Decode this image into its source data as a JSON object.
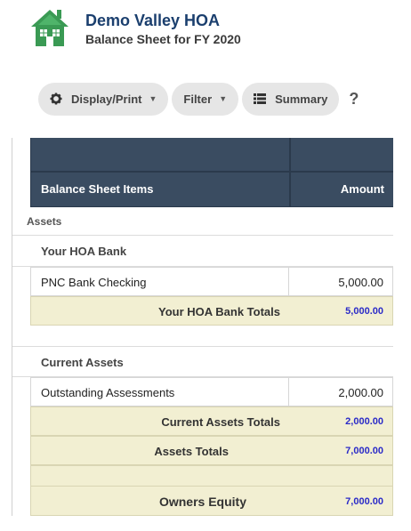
{
  "header": {
    "org_name": "Demo Valley HOA",
    "report_title": "Balance Sheet for FY 2020",
    "logo_icon": "house-icon",
    "logo_color": "#3a9a54"
  },
  "toolbar": {
    "display_print_label": "Display/Print",
    "filter_label": "Filter",
    "summary_label": "Summary",
    "help_label": "?"
  },
  "table": {
    "header_color": "#3a4c61",
    "columns": {
      "items": "Balance Sheet Items",
      "amount": "Amount"
    }
  },
  "assets": {
    "label": "Assets",
    "groups": [
      {
        "name": "Your HOA Bank",
        "items": [
          {
            "name": "PNC Bank Checking",
            "amount": "5,000.00"
          }
        ],
        "total_label": "Your HOA Bank Totals",
        "total_amount": "5,000.00"
      },
      {
        "name": "Current Assets",
        "items": [
          {
            "name": "Outstanding Assessments",
            "amount": "2,000.00"
          }
        ],
        "total_label": "Current Assets Totals",
        "total_amount": "2,000.00"
      }
    ],
    "total_label": "Assets Totals",
    "total_amount": "7,000.00"
  },
  "equity": {
    "label": "Owners Equity",
    "amount": "7,000.00"
  },
  "colors": {
    "total_bg": "#f2efd2",
    "total_amount": "#2a2ac8"
  }
}
